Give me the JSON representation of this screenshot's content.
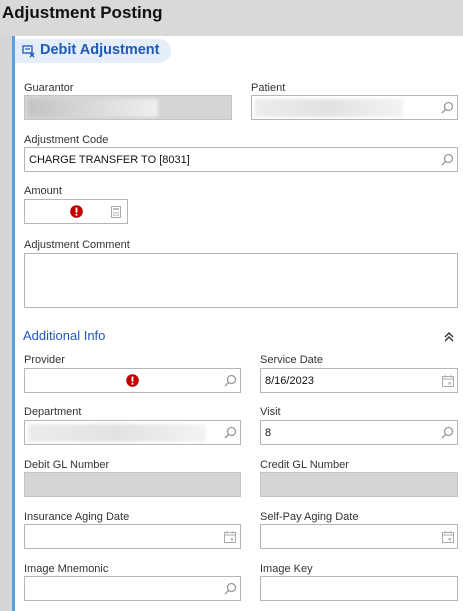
{
  "page": {
    "title": "Adjustment Posting"
  },
  "section": {
    "title": "Debit Adjustment",
    "icon": "debit-adjustment-icon"
  },
  "form": {
    "guarantor": {
      "label": "Guarantor",
      "value": ""
    },
    "patient": {
      "label": "Patient",
      "value": ""
    },
    "adjustment_code": {
      "label": "Adjustment Code",
      "value": "CHARGE TRANSFER TO [8031]"
    },
    "amount": {
      "label": "Amount",
      "value": ""
    },
    "adjustment_comment": {
      "label": "Adjustment Comment",
      "value": ""
    }
  },
  "additional_info": {
    "title": "Additional Info",
    "collapse_icon": "chevron-double-up-icon",
    "provider": {
      "label": "Provider",
      "value": ""
    },
    "service_date": {
      "label": "Service Date",
      "value": "8/16/2023"
    },
    "department": {
      "label": "Department",
      "value": ""
    },
    "visit": {
      "label": "Visit",
      "value": "8"
    },
    "debit_gl_number": {
      "label": "Debit GL Number",
      "value": ""
    },
    "credit_gl_number": {
      "label": "Credit GL Number",
      "value": ""
    },
    "insurance_aging_date": {
      "label": "Insurance Aging Date",
      "value": ""
    },
    "self_pay_aging_date": {
      "label": "Self-Pay Aging Date",
      "value": ""
    },
    "image_mnemonic": {
      "label": "Image Mnemonic",
      "value": ""
    },
    "image_key": {
      "label": "Image Key",
      "value": ""
    }
  },
  "colors": {
    "accent": "#5aa0e0",
    "title_blue": "#1f58b8",
    "error_red": "#c00000",
    "readonly_bg": "#d5d5d5"
  }
}
